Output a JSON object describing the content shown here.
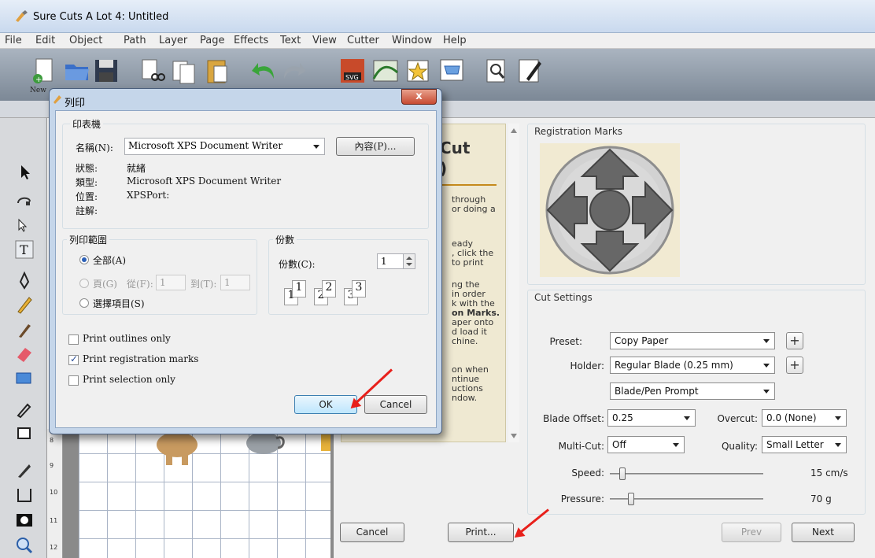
{
  "window": {
    "title": "Sure Cuts A Lot 4: Untitled"
  },
  "menu": [
    "File",
    "Edit",
    "Object",
    "Path",
    "Layer",
    "Page",
    "Effects",
    "Text",
    "View",
    "Cutter",
    "Window",
    "Help"
  ],
  "toolbar": {
    "new_label": "New"
  },
  "ruler": [
    "8",
    "9",
    "10",
    "11",
    "12"
  ],
  "instructions": {
    "heading": [
      "Cut",
      ")"
    ],
    "lines": [
      "through",
      "or doing a",
      "",
      "eady",
      ", click the",
      "to print",
      "",
      "ng the",
      "in order",
      "k with the",
      "on Marks.",
      "aper onto",
      "d load it",
      "chine.",
      "",
      "on when",
      "ntinue",
      "uctions",
      "ndow."
    ]
  },
  "registration": {
    "title": "Registration Marks"
  },
  "cut_settings": {
    "title": "Cut Settings",
    "preset_label": "Preset:",
    "preset_value": "Copy Paper",
    "holder_label": "Holder:",
    "holder_value": "Regular Blade (0.25 mm)",
    "prompt_value": "Blade/Pen Prompt",
    "blade_offset_label": "Blade Offset:",
    "blade_offset_value": "0.25",
    "overcut_label": "Overcut:",
    "overcut_value": "0.0 (None)",
    "multicut_label": "Multi-Cut:",
    "multicut_value": "Off",
    "quality_label": "Quality:",
    "quality_value": "Small Letter",
    "speed_label": "Speed:",
    "speed_value": "15 cm/s",
    "speed_level": 0.06,
    "pressure_label": "Pressure:",
    "pressure_value": "70 g",
    "pressure_level": 0.12
  },
  "wizard_buttons": {
    "cancel": "Cancel",
    "print": "Print...",
    "prev": "Prev",
    "next": "Next"
  },
  "print_dialog": {
    "title": "列印",
    "close": "x",
    "printer_group": "印表機",
    "name_label": "名稱(N):",
    "name_value": "Microsoft XPS Document Writer",
    "properties_button": "內容(P)...",
    "status_label": "狀態:",
    "status_value": "就緒",
    "type_label": "類型:",
    "type_value": "Microsoft XPS Document Writer",
    "where_label": "位置:",
    "where_value": "XPSPort:",
    "comment_label": "註解:",
    "range_group": "列印範圍",
    "all_label": "全部(A)",
    "pages_label": "頁(G)",
    "from_label": "從(F):",
    "from_value": "1",
    "to_label": "到(T):",
    "to_value": "1",
    "selection_label": "選擇項目(S)",
    "copies_group": "份數",
    "copies_label": "份數(C):",
    "copies_value": "1",
    "collate": [
      [
        "1",
        "1"
      ],
      [
        "2",
        "2"
      ],
      [
        "3",
        "3"
      ]
    ],
    "opt_outlines": "Print outlines only",
    "opt_regmarks": "Print registration marks",
    "opt_selection": "Print selection only",
    "ok": "OK",
    "cancel": "Cancel"
  }
}
